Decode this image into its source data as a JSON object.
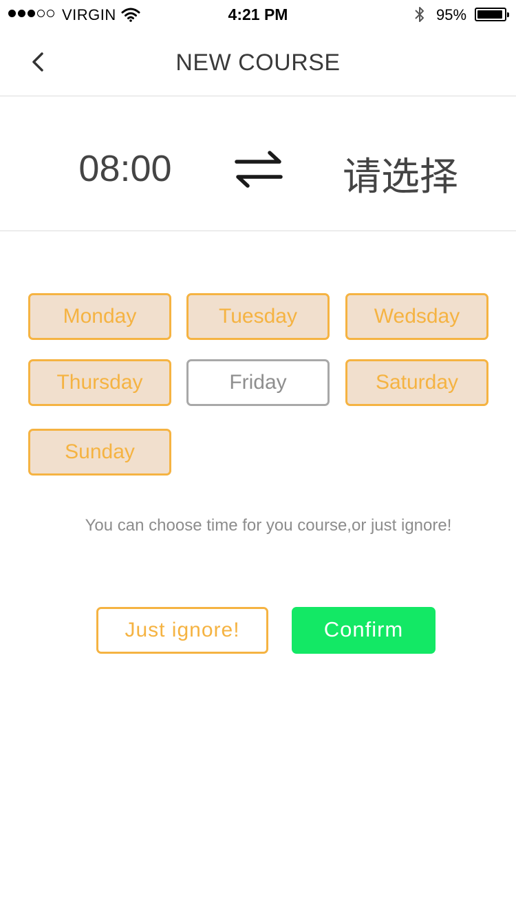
{
  "status_bar": {
    "carrier": "VIRGIN",
    "time": "4:21 PM",
    "battery_percent": "95%",
    "battery_level": 0.95,
    "signal_bars_filled": 3,
    "signal_bars_total": 5,
    "icons": [
      "wifi-icon",
      "bluetooth-icon",
      "battery-icon"
    ]
  },
  "nav": {
    "title": "NEW COURSE",
    "back_icon": "chevron-left-icon"
  },
  "time_range": {
    "start": "08:00",
    "end_placeholder": "请选择",
    "swap_icon": "swap-arrows-icon"
  },
  "days": [
    {
      "label": "Monday",
      "selected": true
    },
    {
      "label": "Tuesday",
      "selected": true
    },
    {
      "label": "Wedsday",
      "selected": true
    },
    {
      "label": "Thursday",
      "selected": true
    },
    {
      "label": "Friday",
      "selected": false
    },
    {
      "label": "Saturday",
      "selected": true
    },
    {
      "label": "Sunday",
      "selected": true
    }
  ],
  "hint": "You can choose time for you course,or just ignore!",
  "actions": {
    "ignore_label": "Just ignore!",
    "confirm_label": "Confirm"
  },
  "colors": {
    "accent_orange": "#f5b342",
    "selected_fill": "#f1dfcd",
    "confirm_green": "#13e865",
    "unselected_border": "#a8a8a8"
  }
}
